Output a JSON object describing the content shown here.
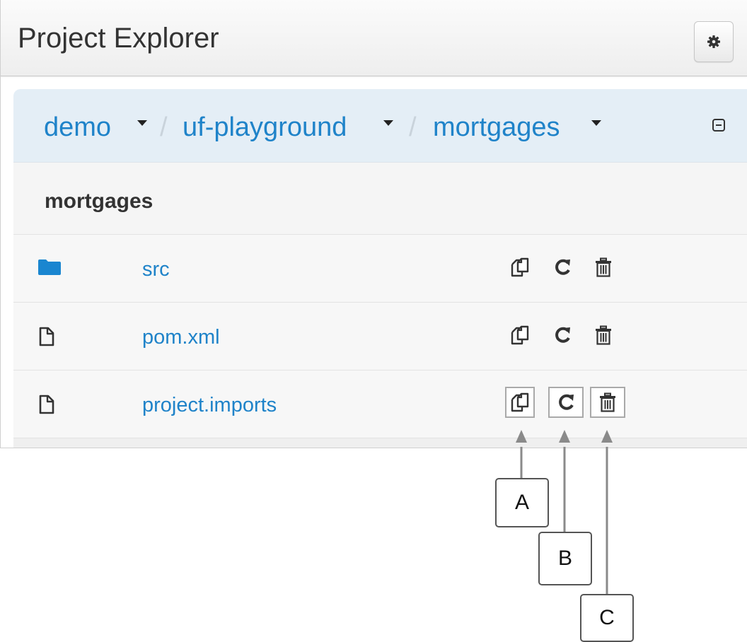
{
  "panel": {
    "title": "Project Explorer",
    "settings_icon": "gear-icon"
  },
  "breadcrumb": {
    "items": [
      {
        "label": "demo"
      },
      {
        "label": "uf-playground"
      },
      {
        "label": "mortgages"
      }
    ],
    "separator": "/",
    "collapse_icon": "collapse-icon"
  },
  "folder": {
    "heading": "mortgages"
  },
  "items": [
    {
      "name": "src",
      "type": "folder",
      "icon": "folder-icon"
    },
    {
      "name": "pom.xml",
      "type": "file",
      "icon": "file-icon"
    },
    {
      "name": "project.imports",
      "type": "file",
      "icon": "file-icon"
    }
  ],
  "actions": [
    {
      "id": "copy",
      "icon": "copy-icon"
    },
    {
      "id": "rename",
      "icon": "rename-icon"
    },
    {
      "id": "delete",
      "icon": "delete-icon"
    }
  ],
  "callouts": [
    "A",
    "B",
    "C"
  ],
  "colors": {
    "link": "#1f83c9",
    "folder": "#1a86d0",
    "breadcrumb_bg": "#e4eef6",
    "text": "#333333"
  }
}
